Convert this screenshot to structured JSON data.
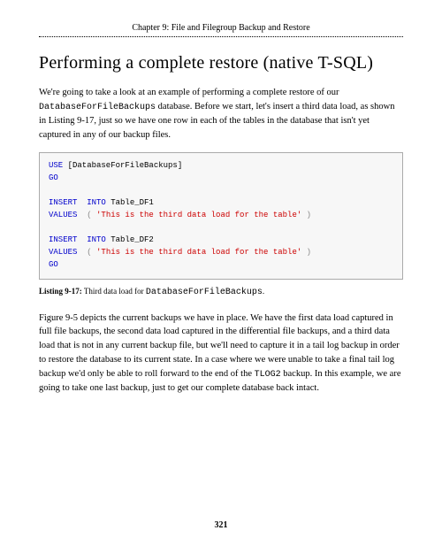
{
  "chapter_header": "Chapter 9: File and Filegroup Backup and Restore",
  "section_title": "Performing a complete restore (native T-SQL)",
  "intro_p1_a": "We're going to take a look at an example of performing a complete restore of our ",
  "intro_db_name": "DatabaseForFileBackups",
  "intro_p1_b": " database. Before we start, let's insert a third data load, as shown in Listing 9-17, just so we have one row in each of the tables in the database that isn't yet captured in any of our backup files.",
  "code": {
    "l1_use": "USE",
    "l1_arg": " [DatabaseForFileBackups]",
    "l2_go": "GO",
    "l4_insert": "INSERT",
    "l4_into": "  INTO",
    "l4_tbl": " Table_DF1",
    "l5_values": "VALUES",
    "l5_paren1": "  ( ",
    "l5_str": "'This is the third data load for the table'",
    "l5_paren2": " )",
    "l7_insert": "INSERT",
    "l7_into": "  INTO",
    "l7_tbl": " Table_DF2",
    "l8_values": "VALUES",
    "l8_paren1": "  ( ",
    "l8_str": "'This is the third data load for the table'",
    "l8_paren2": " )",
    "l9_go": "GO"
  },
  "listing_label": "Listing 9-17:",
  "listing_text_a": " Third data load for ",
  "listing_code": "DatabaseForFileBackups",
  "listing_text_b": ".",
  "p2_a": "Figure 9-5 depicts the current backups we have in place. We have the first data load captured in full file backups, the second data load captured in the differential file backups, and a third data load that is not in any current backup file, but we'll need to capture it in a tail log backup in order to restore the database to its current state. In a case where we were unable to take a final tail log backup we'd only be able to roll forward to the end of the ",
  "p2_code": "TLOG2",
  "p2_b": " backup. In this example, we are going to take one last backup, just to get our complete database back intact.",
  "page_number": "321"
}
